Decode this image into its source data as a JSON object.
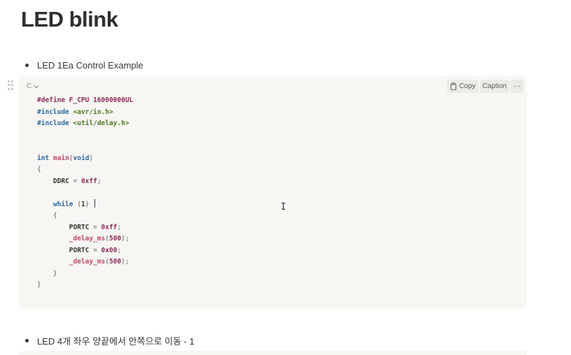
{
  "page": {
    "title": "LED blink"
  },
  "sections": [
    {
      "bullet": "LED 1Ea Control Example"
    },
    {
      "bullet": "LED 4개 좌우 양끝에서 안쪽으로 이동 - 1"
    }
  ],
  "code_block": {
    "language": "C",
    "toolbar": {
      "copy": "Copy",
      "caption": "Caption",
      "more": "···"
    },
    "code_lines": [
      "#define F_CPU 16000000UL",
      "#include <avr/io.h>",
      "#include <util/delay.h>",
      "",
      "",
      "int main(void)",
      "{",
      "    DDRC = 0xff;",
      "",
      "    while (1) ",
      "    {",
      "        PORTC = 0xff;",
      "        _delay_ms(500);",
      "        PORTC = 0x00;",
      "        _delay_ms(500);",
      "    }",
      "}"
    ]
  },
  "icons": {
    "copy": "clipboard-icon",
    "language_dropdown": "chevron-down-icon",
    "drag": "drag-handle-icon",
    "cursor": "text-cursor-icon"
  }
}
